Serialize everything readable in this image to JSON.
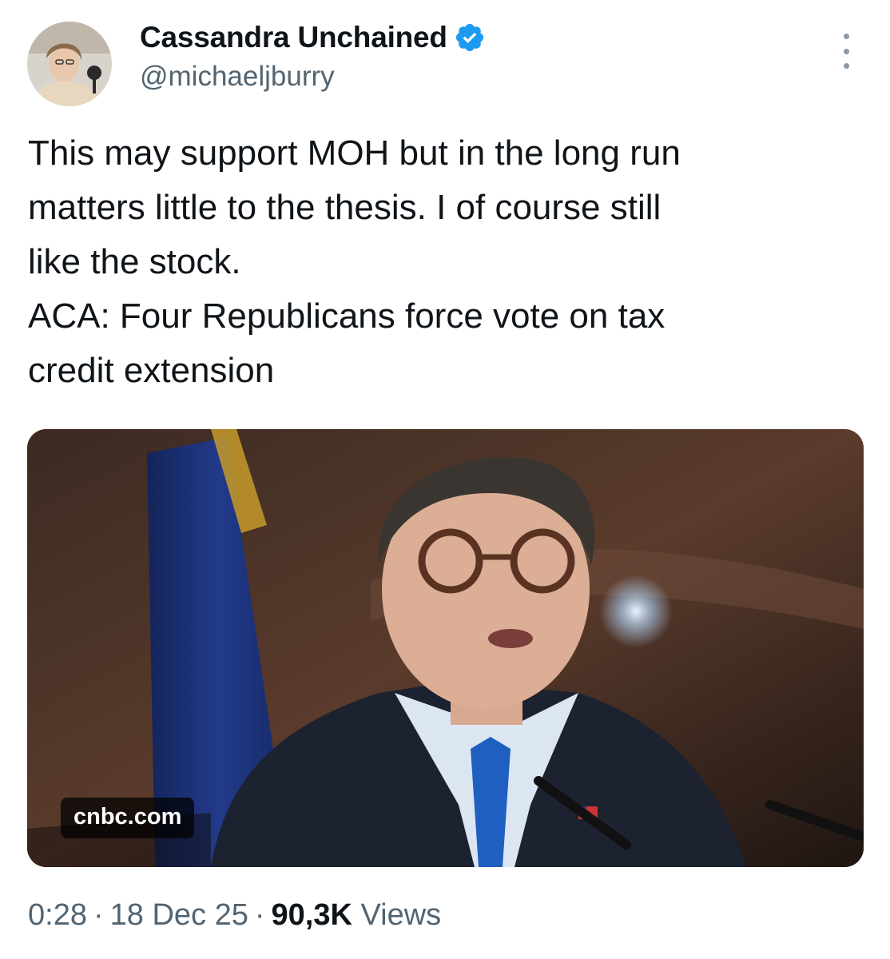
{
  "author": {
    "display_name": "Cassandra Unchained",
    "handle": "@michaeljburry",
    "verified": true,
    "verified_badge_color": "#1d9bf0",
    "avatar_icon": "profile-photo"
  },
  "more_icon": "more-options-icon",
  "tweet": {
    "lines": [
      "This may support MOH but in the long run",
      "matters little to the thesis. I of course still",
      "like the stock.",
      "ACA: Four Republicans force vote on tax",
      "credit extension"
    ]
  },
  "link_card": {
    "domain": "cnbc.com"
  },
  "meta": {
    "time": "0:28",
    "date": "18 Dec 25",
    "views_count": "90,3K",
    "views_label": "Views",
    "separator": "·"
  }
}
